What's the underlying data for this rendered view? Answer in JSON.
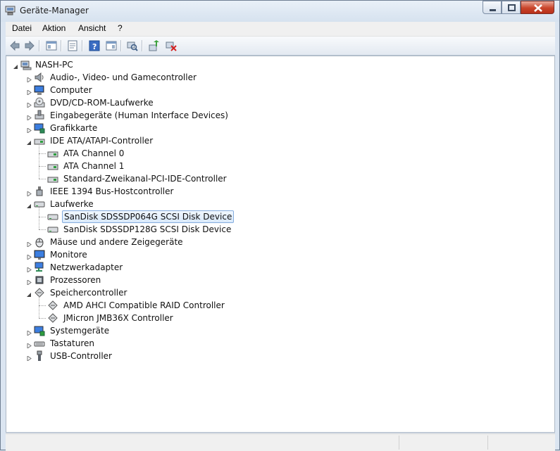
{
  "window": {
    "title": "Geräte-Manager",
    "controls": [
      "minimize",
      "maximize",
      "close"
    ]
  },
  "menubar": {
    "items": [
      "Datei",
      "Aktion",
      "Ansicht",
      "?"
    ]
  },
  "toolbar": {
    "buttons": [
      "back-icon",
      "forward-icon",
      "console-tree-icon",
      "properties-icon",
      "help-icon",
      "show-hide-icon",
      "scan-hardware-icon",
      "update-driver-icon",
      "uninstall-icon"
    ]
  },
  "tree": {
    "root": "NASH-PC",
    "categories": [
      {
        "label": "Audio-, Video- und Gamecontroller",
        "icon": "speaker-icon",
        "expanded": false
      },
      {
        "label": "Computer",
        "icon": "computer-icon",
        "expanded": false
      },
      {
        "label": "DVD/CD-ROM-Laufwerke",
        "icon": "dvd-drive-icon",
        "expanded": false
      },
      {
        "label": "Eingabegeräte (Human Interface Devices)",
        "icon": "hid-icon",
        "expanded": false
      },
      {
        "label": "Grafikkarte",
        "icon": "display-adapter-icon",
        "expanded": false
      },
      {
        "label": "IDE ATA/ATAPI-Controller",
        "icon": "ide-controller-icon",
        "expanded": true,
        "children": [
          "ATA Channel 0",
          "ATA Channel 1",
          "Standard-Zweikanal-PCI-IDE-Controller"
        ]
      },
      {
        "label": "IEEE 1394 Bus-Hostcontroller",
        "icon": "firewire-icon",
        "expanded": false
      },
      {
        "label": "Laufwerke",
        "icon": "disk-drive-icon",
        "expanded": true,
        "children": [
          "SanDisk SDSSDP064G SCSI Disk Device",
          "SanDisk SDSSDP128G SCSI Disk Device"
        ]
      },
      {
        "label": "Mäuse und andere Zeigegeräte",
        "icon": "mouse-icon",
        "expanded": false
      },
      {
        "label": "Monitore",
        "icon": "monitor-icon",
        "expanded": false
      },
      {
        "label": "Netzwerkadapter",
        "icon": "network-adapter-icon",
        "expanded": false
      },
      {
        "label": "Prozessoren",
        "icon": "processor-icon",
        "expanded": false
      },
      {
        "label": "Speichercontroller",
        "icon": "storage-controller-icon",
        "expanded": true,
        "children": [
          "AMD AHCI Compatible RAID Controller",
          "JMicron JMB36X Controller"
        ]
      },
      {
        "label": "Systemgeräte",
        "icon": "system-devices-icon",
        "expanded": false
      },
      {
        "label": "Tastaturen",
        "icon": "keyboard-icon",
        "expanded": false
      },
      {
        "label": "USB-Controller",
        "icon": "usb-icon",
        "expanded": false
      }
    ],
    "selected": "SanDisk SDSSDP064G SCSI Disk Device"
  },
  "colors": {
    "selection_border": "#84acdd",
    "selection_fill": "#dce9fb",
    "close_button": "#c9452b",
    "frame": "#dbe5f1"
  }
}
